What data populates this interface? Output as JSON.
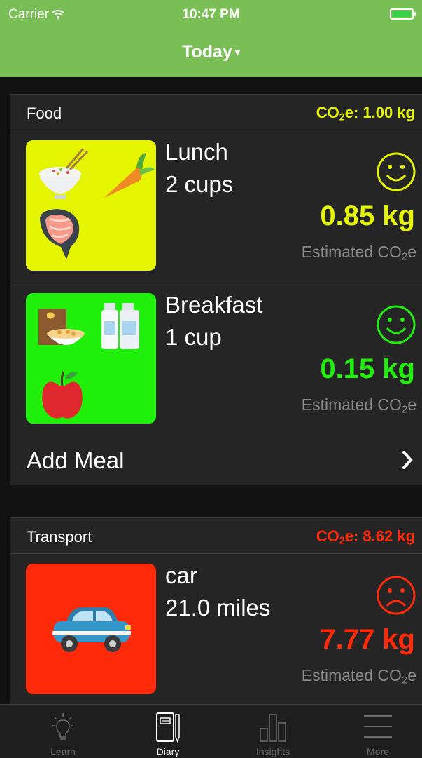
{
  "status_bar": {
    "carrier": "Carrier",
    "time": "10:47 PM"
  },
  "header": {
    "title": "Today",
    "caret": "▾"
  },
  "colors": {
    "header": "#79bf55",
    "yellow": "#e5f400",
    "green": "#20ef0c",
    "red": "#ff2a0a"
  },
  "food": {
    "label": "Food",
    "co2_prefix": "CO",
    "co2_sub": "2",
    "co2_suffix": "e: 1.00 kg",
    "entries": [
      {
        "name": "Lunch",
        "qty": "2 cups",
        "amount": "0.85 kg",
        "est_prefix": "Estimated CO",
        "est_sub": "2",
        "est_suffix": "e",
        "face": "smile-icon",
        "icons": [
          "rice-bowl-icon",
          "carrot-icon",
          "salmon-steak-icon"
        ]
      },
      {
        "name": "Breakfast",
        "qty": "1 cup",
        "amount": "0.15 kg",
        "est_prefix": "Estimated CO",
        "est_sub": "2",
        "est_suffix": "e",
        "face": "smile-icon",
        "icons": [
          "cereal-icon",
          "milk-bottles-icon",
          "apple-icon"
        ]
      }
    ],
    "add_label": "Add Meal"
  },
  "transport": {
    "label": "Transport",
    "co2_prefix": "CO",
    "co2_sub": "2",
    "co2_suffix": "e: 8.62 kg",
    "entries": [
      {
        "name": "car",
        "qty": "21.0 miles",
        "amount": "7.77 kg",
        "est_prefix": "Estimated CO",
        "est_sub": "2",
        "est_suffix": "e",
        "face": "frown-icon",
        "icons": [
          "car-icon"
        ]
      }
    ]
  },
  "tabs": [
    {
      "label": "Learn",
      "icon": "lightbulb-icon"
    },
    {
      "label": "Diary",
      "icon": "notebook-icon",
      "active": true
    },
    {
      "label": "Insights",
      "icon": "bar-chart-icon"
    },
    {
      "label": "More",
      "icon": "menu-icon"
    }
  ]
}
